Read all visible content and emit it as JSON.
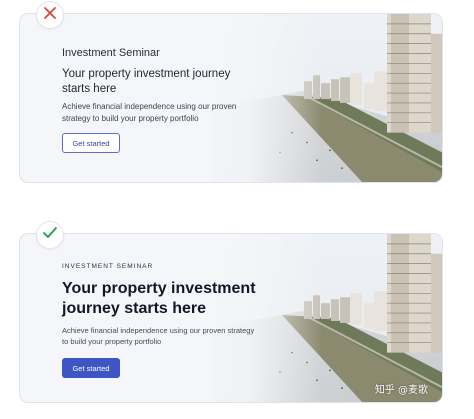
{
  "bad_example": {
    "eyebrow": "Investment Seminar",
    "headline": "Your property investment journey starts here",
    "subtext": "Achieve financial independence using our proven strategy to build your property portfolio",
    "cta_label": "Get started",
    "badge_icon": "cross-icon",
    "badge_color": "#d9443b"
  },
  "good_example": {
    "eyebrow": "INVESTMENT SEMINAR",
    "headline": "Your property investment journey starts here",
    "subtext": "Achieve financial independence using our proven strategy to build your property portfolio",
    "cta_label": "Get started",
    "badge_icon": "check-icon",
    "badge_color": "#1f9a4d",
    "accent": "#3e55c6"
  },
  "watermark": "知乎 @麦歌"
}
